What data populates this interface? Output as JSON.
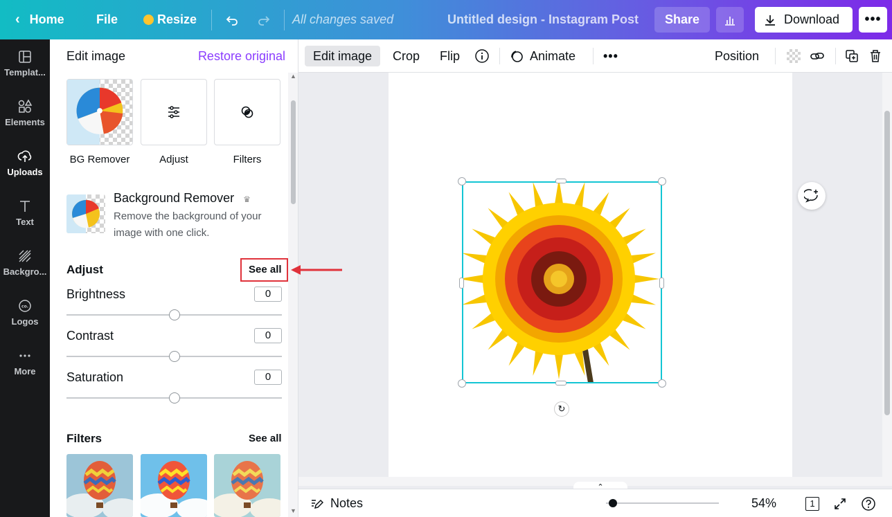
{
  "topbar": {
    "home": "Home",
    "file": "File",
    "resize": "Resize",
    "saved_status": "All changes saved",
    "doc_title": "Untitled design - Instagram Post",
    "share": "Share",
    "download": "Download",
    "more": "•••"
  },
  "rail": {
    "items": [
      {
        "label": "Templat...",
        "icon": "templates-icon"
      },
      {
        "label": "Elements",
        "icon": "elements-icon"
      },
      {
        "label": "Uploads",
        "icon": "uploads-icon"
      },
      {
        "label": "Text",
        "icon": "text-icon"
      },
      {
        "label": "Backgro...",
        "icon": "background-icon"
      },
      {
        "label": "Logos",
        "icon": "logos-icon"
      },
      {
        "label": "More",
        "icon": "more-icon"
      }
    ]
  },
  "panel": {
    "title": "Edit image",
    "restore": "Restore original",
    "tools": [
      {
        "label": "BG Remover"
      },
      {
        "label": "Adjust"
      },
      {
        "label": "Filters"
      }
    ],
    "bg_remover": {
      "title": "Background Remover",
      "desc": "Remove the background of your image with one click."
    },
    "adjust": {
      "title": "Adjust",
      "see_all": "See all",
      "sliders": [
        {
          "label": "Brightness",
          "value": "0"
        },
        {
          "label": "Contrast",
          "value": "0"
        },
        {
          "label": "Saturation",
          "value": "0"
        }
      ]
    },
    "filters": {
      "title": "Filters",
      "see_all": "See all"
    }
  },
  "ctx_toolbar": {
    "edit_image": "Edit image",
    "crop": "Crop",
    "flip": "Flip",
    "animate": "Animate",
    "more": "•••",
    "position": "Position"
  },
  "bottombar": {
    "notes": "Notes",
    "zoom": "54%",
    "page": "1"
  },
  "colors": {
    "accent": "#8b3dff",
    "selection": "#13c5d4",
    "annotation": "#e0323b"
  }
}
